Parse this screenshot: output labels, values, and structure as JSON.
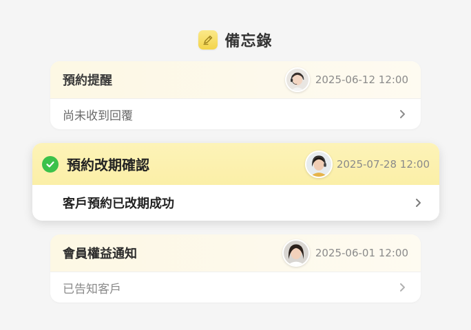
{
  "header": {
    "title": "備忘錄",
    "icon": "pencil-note-icon",
    "icon_bg": "#f5d94f"
  },
  "memos": [
    {
      "title": "預約提醒",
      "timestamp": "2025-06-12 12:00",
      "status_text": "尚未收到回覆",
      "avatar": "agent-headset-avatar",
      "highlighted": false
    },
    {
      "title": "預約改期確認",
      "timestamp": "2025-07-28 12:00",
      "status_text": "客戶預約已改期成功",
      "avatar": "agent-headset-avatar",
      "highlighted": true,
      "check_color": "#3bc14a"
    },
    {
      "title": "會員權益通知",
      "timestamp": "2025-06-01 12:00",
      "status_text": "已告知客戶",
      "avatar": "agent-avatar",
      "highlighted": false
    }
  ],
  "colors": {
    "background": "#f5f5f5",
    "highlight": "#fbefa7",
    "card_header": "#fdf8e4"
  }
}
